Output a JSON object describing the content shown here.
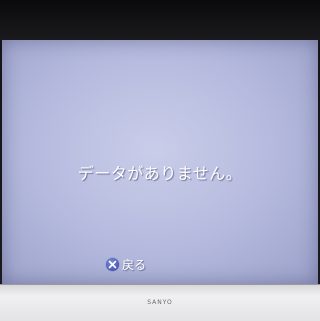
{
  "screen": {
    "message": "データがありません。",
    "back_hint": {
      "button_icon": "cross-button-icon",
      "label": "戻る"
    },
    "background_color": "#b8bde0",
    "text_color": "#ffffff"
  },
  "bezel": {
    "brand": "SANYO"
  }
}
